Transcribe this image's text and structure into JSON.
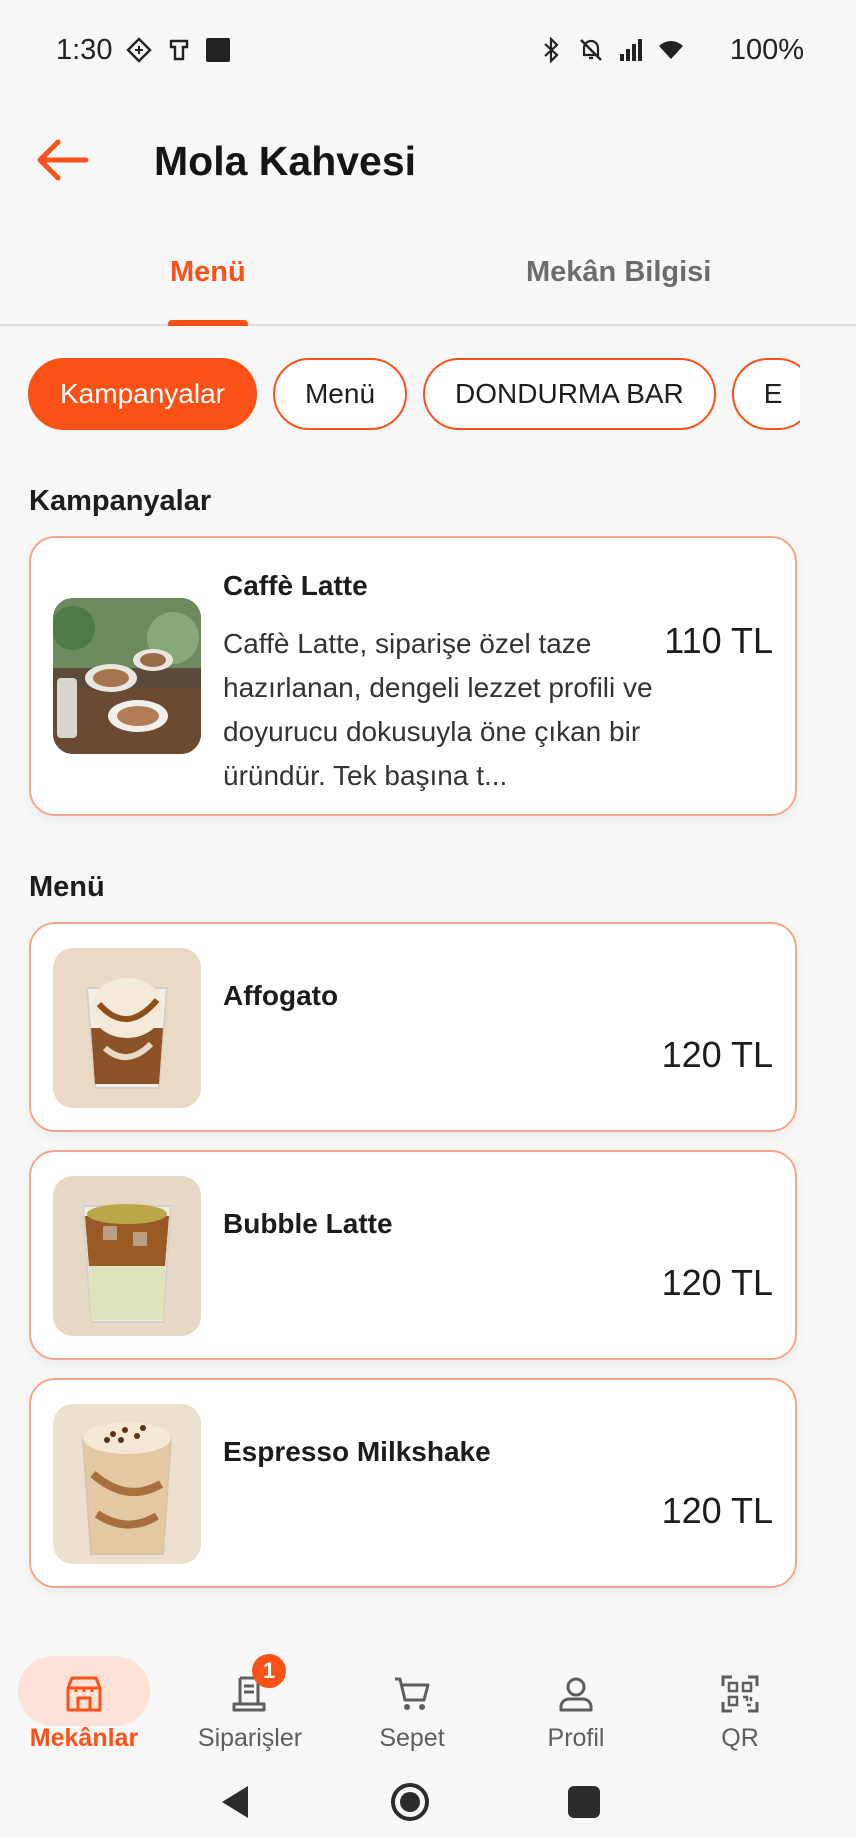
{
  "status": {
    "time": "1:30",
    "battery": "100%"
  },
  "header": {
    "title": "Mola Kahvesi"
  },
  "tabs": [
    {
      "label": "Menü",
      "active": true
    },
    {
      "label": "Mekân Bilgisi",
      "active": false
    }
  ],
  "chips": [
    {
      "label": "Kampanyalar",
      "active": true
    },
    {
      "label": "Menü",
      "active": false
    },
    {
      "label": "DONDURMA BAR",
      "active": false
    },
    {
      "label": "E",
      "active": false
    }
  ],
  "sections": {
    "campaigns": {
      "title": "Kampanyalar",
      "items": [
        {
          "name": "Caffè Latte",
          "description": "Caffè Latte, siparişe özel taze hazırlanan, dengeli lezzet profili ve doyurucu dokusuyla öne çıkan bir üründür. Tek başına t...",
          "price": "110 TL"
        }
      ]
    },
    "menu": {
      "title": "Menü",
      "items": [
        {
          "name": "Affogato",
          "price": "120 TL"
        },
        {
          "name": "Bubble Latte",
          "price": "120 TL"
        },
        {
          "name": "Espresso Milkshake",
          "price": "120 TL"
        }
      ]
    }
  },
  "bottom_nav": [
    {
      "label": "Mekânlar",
      "icon": "store-icon",
      "active": true
    },
    {
      "label": "Siparişler",
      "icon": "receipt-icon",
      "badge": "1"
    },
    {
      "label": "Sepet",
      "icon": "cart-icon"
    },
    {
      "label": "Profil",
      "icon": "person-icon"
    },
    {
      "label": "QR",
      "icon": "qr-icon"
    }
  ],
  "colors": {
    "accent": "#fa5117",
    "card_border": "#f6a688",
    "active_pill": "#fde3d7"
  }
}
